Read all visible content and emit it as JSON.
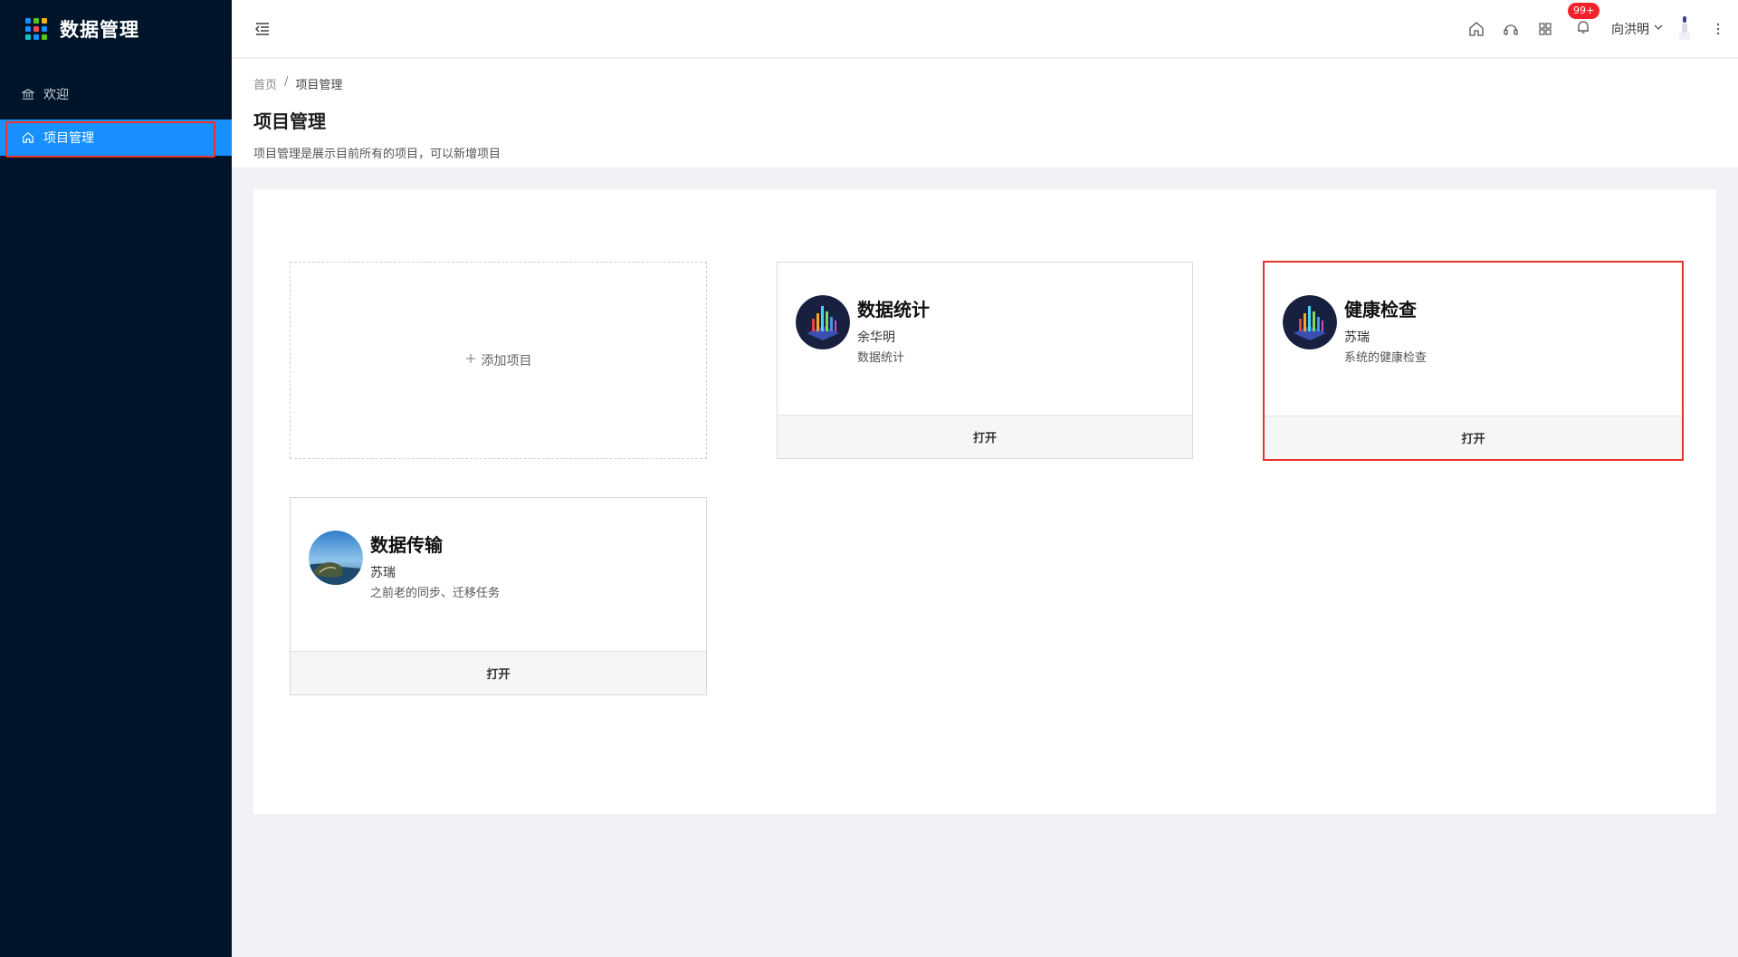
{
  "app": {
    "title": "数据管理",
    "logo_colors": [
      "#1890ff",
      "#52c41a",
      "#faad14",
      "#1890ff",
      "#ff4d4f",
      "#1890ff",
      "#13c2c2",
      "#1890ff",
      "#52c41a"
    ]
  },
  "sidebar": {
    "items": [
      {
        "label": "欢迎",
        "icon": "bank-icon",
        "active": false
      },
      {
        "label": "项目管理",
        "icon": "home-icon",
        "active": true
      }
    ]
  },
  "header": {
    "notification_badge": "99+",
    "user_name": "向洪明"
  },
  "breadcrumb": {
    "home": "首页",
    "separator": "/",
    "current": "项目管理"
  },
  "page": {
    "title": "项目管理",
    "description": "项目管理是展示目前所有的项目，可以新增项目"
  },
  "add_card": {
    "label": "添加项目"
  },
  "projects": [
    {
      "title": "数据统计",
      "owner": "余华明",
      "desc": "数据统计",
      "open_label": "打开",
      "avatar": "chart-avatar"
    },
    {
      "title": "健康检查",
      "owner": "苏瑞",
      "desc": "系统的健康检查",
      "open_label": "打开",
      "avatar": "chart-avatar"
    },
    {
      "title": "数据传输",
      "owner": "苏瑞",
      "desc": "之前老的同步、迁移任务",
      "open_label": "打开",
      "avatar": "landscape-avatar"
    }
  ]
}
